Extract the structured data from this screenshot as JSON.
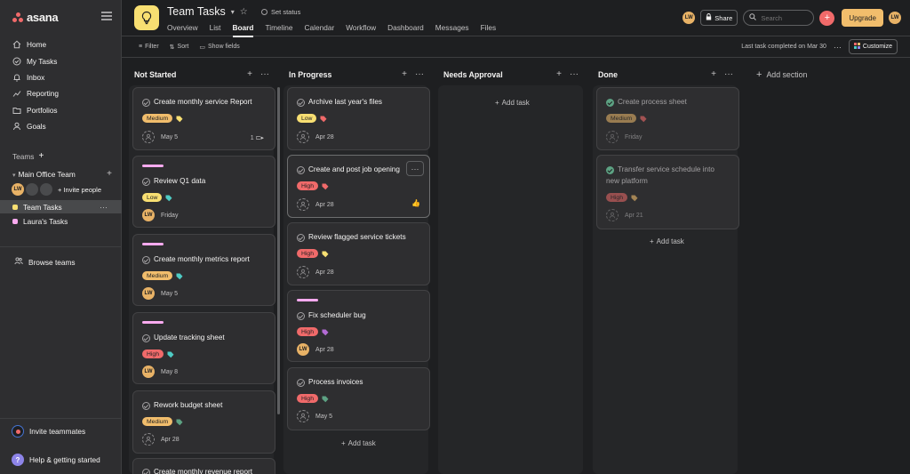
{
  "app": {
    "name": "asana"
  },
  "sidebar": {
    "nav": [
      {
        "label": "Home",
        "icon": "home-icon"
      },
      {
        "label": "My Tasks",
        "icon": "check-circle-icon"
      },
      {
        "label": "Inbox",
        "icon": "bell-icon"
      },
      {
        "label": "Reporting",
        "icon": "chart-icon"
      },
      {
        "label": "Portfolios",
        "icon": "folder-icon"
      },
      {
        "label": "Goals",
        "icon": "person-icon"
      }
    ],
    "teams_label": "Teams",
    "team_name": "Main Office Team",
    "user_initials": "LW",
    "invite_people": "Invite people",
    "projects": [
      {
        "label": "Team Tasks",
        "color": "#f8df72"
      },
      {
        "label": "Laura's Tasks",
        "color": "#f9aaef"
      }
    ],
    "browse_teams": "Browse teams",
    "invite_teammates": "Invite teammates",
    "help": "Help & getting started"
  },
  "header": {
    "title": "Team Tasks",
    "set_status": "Set status",
    "tabs": [
      "Overview",
      "List",
      "Board",
      "Timeline",
      "Calendar",
      "Workflow",
      "Dashboard",
      "Messages",
      "Files"
    ],
    "active_tab": "Board",
    "share": "Share",
    "search_placeholder": "Search",
    "upgrade": "Upgrade",
    "user_initials": "LW"
  },
  "toolbar": {
    "filter": "Filter",
    "sort": "Sort",
    "show_fields": "Show fields",
    "last_completed": "Last task completed on Mar 30",
    "customize": "Customize"
  },
  "colors": {
    "medium": "#f1bd6c",
    "low": "#f8df72",
    "high": "#f06a6a",
    "stripe": "#f9aaef"
  },
  "board": {
    "add_section": "Add section",
    "add_task": "Add task",
    "columns": [
      {
        "name": "Not Started",
        "cards": [
          {
            "title": "Create monthly service Report",
            "priority": "Medium",
            "tag_color": "#f8df72",
            "assignee": "",
            "date": "May 5",
            "subtasks": "1"
          },
          {
            "title": "Review Q1 data",
            "priority": "Low",
            "tag_color": "#4ecbc4",
            "assignee": "LW",
            "date": "Friday"
          },
          {
            "title": "Create monthly metrics report",
            "priority": "Medium",
            "tag_color": "#4ecbc4",
            "assignee": "LW",
            "date": "May 5"
          },
          {
            "title": "Update tracking sheet",
            "priority": "High",
            "tag_color": "#4ecbc4",
            "assignee": "LW",
            "date": "May 8"
          },
          {
            "title": "Rework budget sheet",
            "priority": "Medium",
            "tag_color": "#5da283",
            "assignee": "",
            "date": "Apr 28"
          },
          {
            "title": "Create monthly revenue report"
          }
        ]
      },
      {
        "name": "In Progress",
        "cards": [
          {
            "title": "Archive last year's files",
            "priority": "Low",
            "tag_color": "#f06a6a",
            "assignee": "",
            "date": "Apr 28"
          },
          {
            "title": "Create and post job opening",
            "priority": "High",
            "tag_color": "#f06a6a",
            "assignee": "",
            "date": "Apr 28"
          },
          {
            "title": "Review flagged service tickets",
            "priority": "High",
            "tag_color": "#f8df72",
            "assignee": "",
            "date": "Apr 28"
          },
          {
            "title": "Fix scheduler bug",
            "priority": "High",
            "tag_color": "#b36bd4",
            "assignee": "LW",
            "date": "Apr 28"
          },
          {
            "title": "Process invoices",
            "priority": "High",
            "tag_color": "#5da283",
            "assignee": "",
            "date": "May 5"
          }
        ]
      },
      {
        "name": "Needs Approval",
        "cards": []
      },
      {
        "name": "Done",
        "cards": [
          {
            "title": "Create process sheet",
            "priority": "Medium",
            "tag_color": "#f06a6a",
            "assignee": "",
            "date": "Friday"
          },
          {
            "title_line1": "Transfer service schedule into",
            "title_line2": "new platform",
            "priority": "High",
            "tag_color": "#f1bd6c",
            "assignee": "",
            "date": "Apr 21"
          }
        ]
      }
    ]
  }
}
